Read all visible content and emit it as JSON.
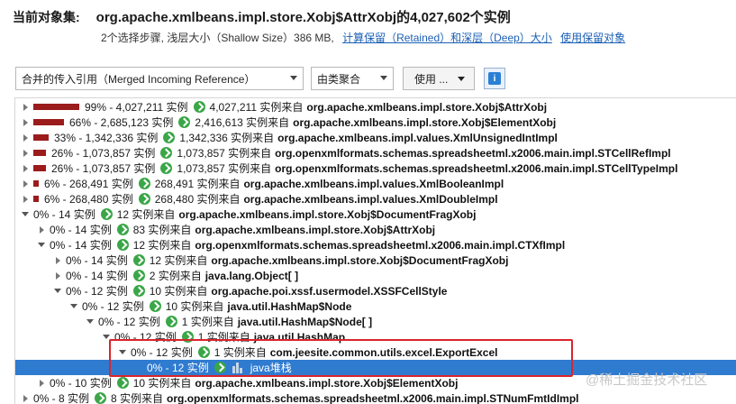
{
  "header": {
    "label": "当前对象集:",
    "title": "org.apache.xmlbeans.impl.store.Xobj$AttrXobj的4,027,602个实例",
    "summary": "2个选择步骤, 浅层大小（Shallow Size）386 MB,",
    "link_retained": "计算保留（Retained）和深层（Deep）大小",
    "link_use_retained": "使用保留对象"
  },
  "toolbar": {
    "reference_combo": "合并的传入引用（Merged Incoming Reference）",
    "group_combo": "由类聚合",
    "use_button": "使用 ...",
    "info_button": "i"
  },
  "tree": {
    "rows": [
      {
        "indent": 0,
        "expander": "right",
        "bar_pct": 99,
        "pct": "99% - 4,027,211 实例",
        "from": "4,027,211 实例来自",
        "cls": "org.apache.xmlbeans.impl.store.Xobj$AttrXobj"
      },
      {
        "indent": 0,
        "expander": "right",
        "bar_pct": 66,
        "pct": "66% - 2,685,123 实例",
        "from": "2,416,613 实例来自",
        "cls": "org.apache.xmlbeans.impl.store.Xobj$ElementXobj"
      },
      {
        "indent": 0,
        "expander": "right",
        "bar_pct": 33,
        "pct": "33% - 1,342,336 实例",
        "from": "1,342,336 实例来自",
        "cls": "org.apache.xmlbeans.impl.values.XmlUnsignedIntImpl"
      },
      {
        "indent": 0,
        "expander": "right",
        "bar_pct": 26,
        "pct": "26% - 1,073,857 实例",
        "from": "1,073,857 实例来自",
        "cls": "org.openxmlformats.schemas.spreadsheetml.x2006.main.impl.STCellRefImpl"
      },
      {
        "indent": 0,
        "expander": "right",
        "bar_pct": 26,
        "pct": "26% - 1,073,857 实例",
        "from": "1,073,857 实例来自",
        "cls": "org.openxmlformats.schemas.spreadsheetml.x2006.main.impl.STCellTypeImpl"
      },
      {
        "indent": 0,
        "expander": "right",
        "bar_pct": 6,
        "pct": "6% - 268,491 实例",
        "from": "268,491 实例来自",
        "cls": "org.apache.xmlbeans.impl.values.XmlBooleanImpl"
      },
      {
        "indent": 0,
        "expander": "right",
        "bar_pct": 6,
        "pct": "6% - 268,480 实例",
        "from": "268,480 实例来自",
        "cls": "org.apache.xmlbeans.impl.values.XmlDoubleImpl"
      },
      {
        "indent": 0,
        "expander": "down",
        "bar_pct": 0,
        "pct": "0% - 14 实例",
        "from": "12 实例来自",
        "cls": "org.apache.xmlbeans.impl.store.Xobj$DocumentFragXobj"
      },
      {
        "indent": 1,
        "expander": "right",
        "bar_pct": 0,
        "pct": "0% - 14 实例",
        "from": "83 实例来自",
        "cls": "org.apache.xmlbeans.impl.store.Xobj$AttrXobj"
      },
      {
        "indent": 1,
        "expander": "down",
        "bar_pct": 0,
        "pct": "0% - 14 实例",
        "from": "12 实例来自",
        "cls": "org.openxmlformats.schemas.spreadsheetml.x2006.main.impl.CTXfImpl"
      },
      {
        "indent": 2,
        "expander": "right",
        "bar_pct": 0,
        "pct": "0% - 14 实例",
        "from": "12 实例来自",
        "cls": "org.apache.xmlbeans.impl.store.Xobj$DocumentFragXobj"
      },
      {
        "indent": 2,
        "expander": "right",
        "bar_pct": 0,
        "pct": "0% - 14 实例",
        "from": "2 实例来自",
        "cls": "java.lang.Object[ ]"
      },
      {
        "indent": 2,
        "expander": "down",
        "bar_pct": 0,
        "pct": "0% - 12 实例",
        "from": "10 实例来自",
        "cls": "org.apache.poi.xssf.usermodel.XSSFCellStyle"
      },
      {
        "indent": 3,
        "expander": "down",
        "bar_pct": 0,
        "pct": "0% - 12 实例",
        "from": "10 实例来自",
        "cls": "java.util.HashMap$Node"
      },
      {
        "indent": 4,
        "expander": "down",
        "bar_pct": 0,
        "pct": "0% - 12 实例",
        "from": "1 实例来自",
        "cls": "java.util.HashMap$Node[ ]"
      },
      {
        "indent": 5,
        "expander": "down",
        "bar_pct": 0,
        "pct": "0% - 12 实例",
        "from": "1 实例来自",
        "cls": "java.util.HashMap"
      },
      {
        "indent": 6,
        "expander": "down",
        "bar_pct": 0,
        "pct": "0% - 12 实例",
        "from": "1 实例来自",
        "cls": "com.jeesite.common.utils.excel.ExportExcel"
      },
      {
        "indent": 7,
        "expander": "blank",
        "bar_pct": 0,
        "pct": "0% - 12 实例",
        "from": "",
        "cls": "java堆栈",
        "selected": true,
        "stack": true
      },
      {
        "indent": 1,
        "expander": "right",
        "bar_pct": 0,
        "pct": "0% - 10 实例",
        "from": "10 实例来自",
        "cls": "org.apache.xmlbeans.impl.store.Xobj$ElementXobj"
      },
      {
        "indent": 0,
        "expander": "right",
        "bar_pct": 0,
        "pct": "0% - 8 实例",
        "from": "8 实例来自",
        "cls": "org.openxmlformats.schemas.spreadsheetml.x2006.main.impl.STNumFmtIdImpl"
      }
    ]
  },
  "watermark": "@稀土掘金技术社区",
  "colors": {
    "bar": "#9b1c1c",
    "selection": "#2f7bd0",
    "highlight_box": "#d9252b",
    "link": "#1a5fb4",
    "icon_green": "#3aa648"
  }
}
